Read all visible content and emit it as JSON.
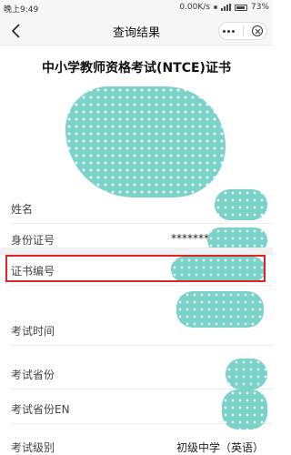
{
  "status_bar": {
    "time": "晚上9:49",
    "network_speed": "0.00K/s",
    "battery": "73%"
  },
  "nav": {
    "title": "查询结果",
    "back_icon": "back-chevron-icon",
    "more_icon": "more-dots-icon",
    "close_icon": "close-circle-icon"
  },
  "page_heading": "中小学教师资格考试(NTCE)证书",
  "fields": [
    {
      "label": "姓名",
      "value": ""
    },
    {
      "label": "身份证号",
      "value": "********"
    },
    {
      "label": "证书编号",
      "value": ""
    },
    {
      "label": "考试时间",
      "value": ""
    },
    {
      "label": "考试省份",
      "value": ""
    },
    {
      "label": "考试省份EN",
      "value": ""
    },
    {
      "label": "考试级别",
      "value": "初级中学（英语）"
    }
  ],
  "colors": {
    "mask": "#79d3c8",
    "highlight": "#d9262b"
  }
}
